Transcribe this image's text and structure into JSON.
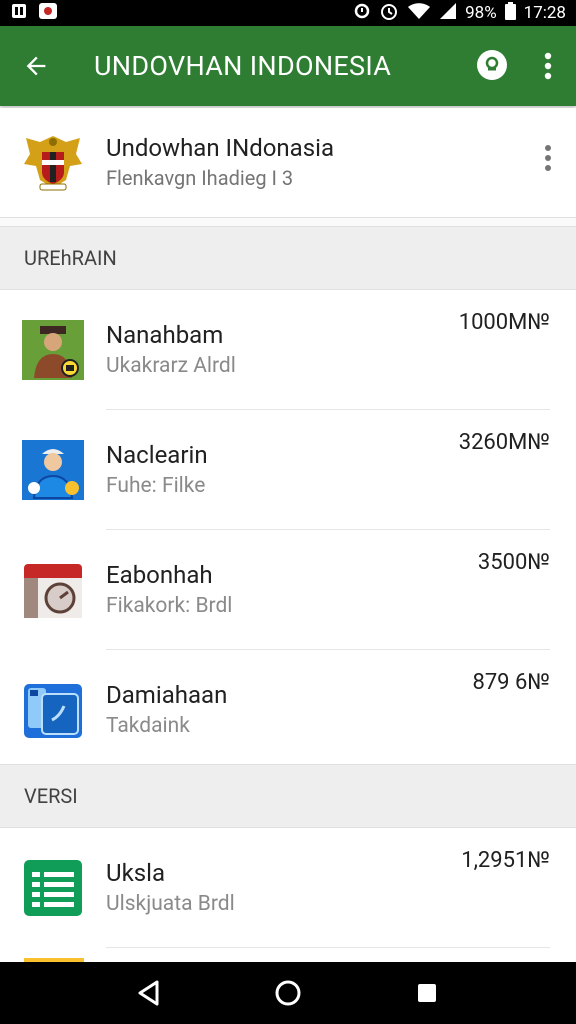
{
  "status_bar": {
    "battery": "98%",
    "time": "17:28",
    "icons": [
      "notification-icon",
      "gallery-icon",
      "sync-icon",
      "alarm-icon",
      "wifi-icon",
      "signal-icon",
      "battery-icon"
    ]
  },
  "app_bar": {
    "title": "UNDOVHAN INDONESIA",
    "color": "#2e7d32"
  },
  "header": {
    "title": "Undowhan INdonasia",
    "subtitle": "Flenkavgn Ihadieg I 3"
  },
  "sections": [
    {
      "title": "UREhRAIN",
      "items": [
        {
          "title": "Nanahbam",
          "subtitle": "Ukakrarz Alrdl",
          "size": "1000M№",
          "icon": "figure-app-icon"
        },
        {
          "title": "Naclearin",
          "subtitle": "Fuhe: Filke",
          "size": "3260M№",
          "icon": "person-app-icon"
        },
        {
          "title": "Eabonhah",
          "subtitle": "Fikakork: Brdl",
          "size": "3500№",
          "icon": "box-app-icon"
        },
        {
          "title": "Damiahaan",
          "subtitle": "Takdaink",
          "size": "879 6№",
          "icon": "folder-app-icon"
        }
      ]
    },
    {
      "title": "VERSI",
      "items": [
        {
          "title": "Uksla",
          "subtitle": "Ulskjuata Brdl",
          "size": "1,2951№",
          "icon": "sheets-app-icon"
        }
      ]
    }
  ]
}
